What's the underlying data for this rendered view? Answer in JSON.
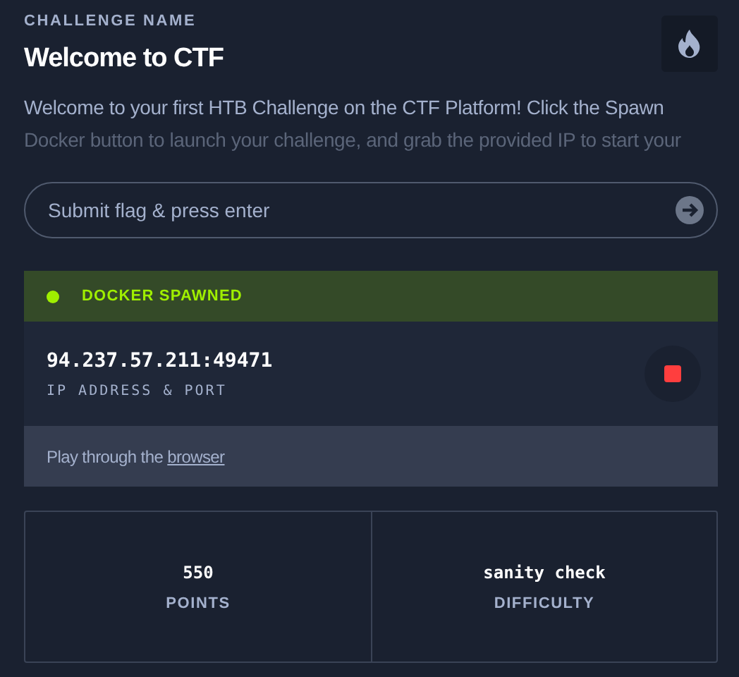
{
  "challenge": {
    "label": "CHALLENGE NAME",
    "title": "Welcome to CTF",
    "description_lines": [
      "Welcome to your first HTB Challenge on the CTF Platform! Click the Spawn",
      "Docker button to launch your challenge, and grab the provided IP to start your"
    ]
  },
  "flag_field": {
    "placeholder": "Submit flag & press enter"
  },
  "docker": {
    "status": "DOCKER SPAWNED",
    "address": "94.237.57.211:49471",
    "address_label": "IP ADDRESS & PORT",
    "browser_text": "Play through the ",
    "browser_link": "browser"
  },
  "stats": [
    {
      "value": "550",
      "label": "POINTS"
    },
    {
      "value": "sanity check",
      "label": "DIFFICULTY"
    }
  ]
}
